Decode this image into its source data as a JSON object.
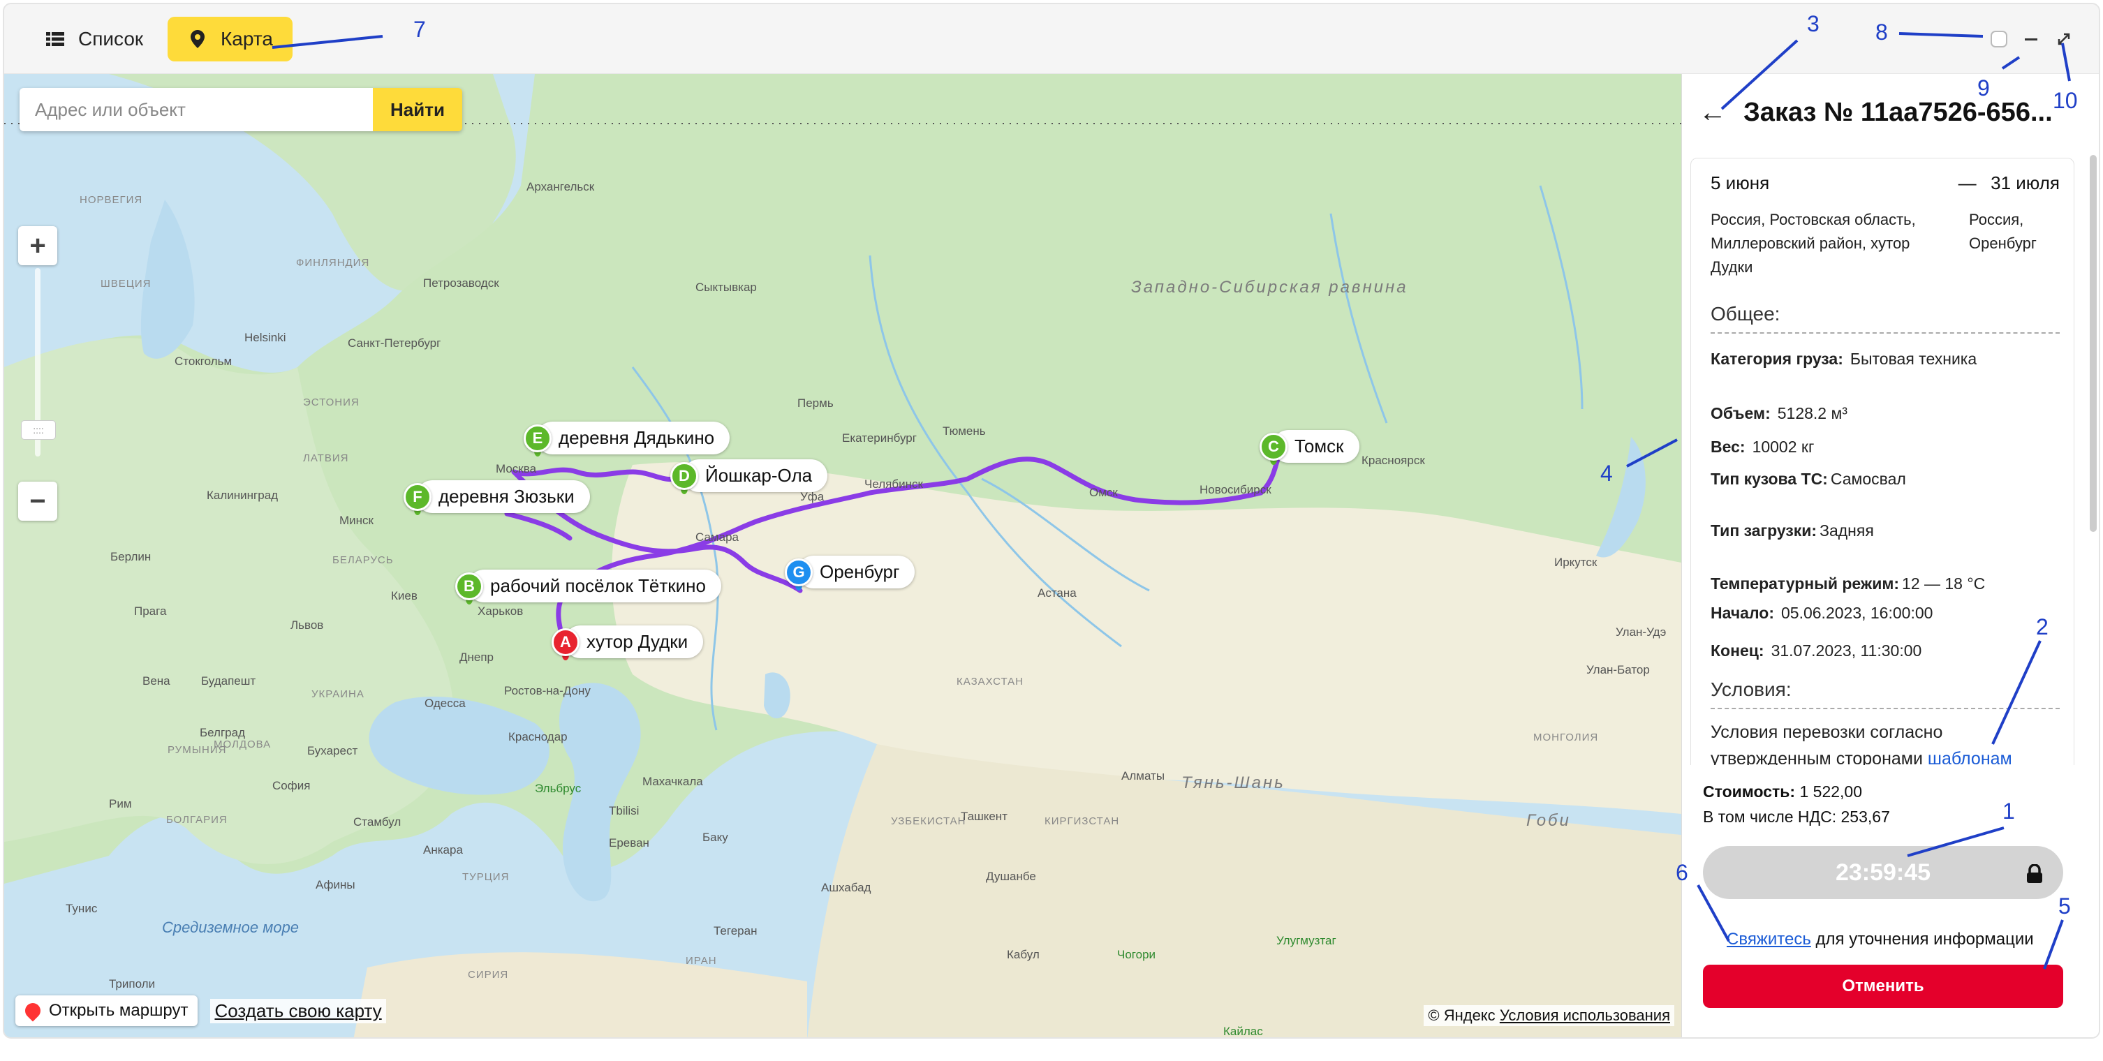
{
  "topbar": {
    "tab_list_label": "Список",
    "tab_map_label": "Карта",
    "list_icon": "list-icon",
    "map_icon": "map-pin-icon"
  },
  "window_controls": {
    "checkbox_icon": "checkbox-icon",
    "minimize_icon": "minimize-icon",
    "expand_icon": "expand-icon"
  },
  "map": {
    "search_placeholder": "Адрес или объект",
    "search_button": "Найти",
    "zoom_in": "+",
    "zoom_out": "−",
    "open_route": "Открыть маршрут",
    "create_map": "Создать свою карту",
    "copyright": "© Яндекс",
    "terms": "Условия использования",
    "route_color": "#8a3ce6",
    "markers": [
      {
        "letter": "A",
        "label": "хутор Дудки",
        "color": "#e8232f"
      },
      {
        "letter": "B",
        "label": "рабочий посёлок Тёткино",
        "color": "#5cb82a"
      },
      {
        "letter": "C",
        "label": "Томск",
        "color": "#5cb82a"
      },
      {
        "letter": "D",
        "label": "Йошкар-Ола",
        "color": "#5cb82a"
      },
      {
        "letter": "E",
        "label": "деревня Дядькино",
        "color": "#5cb82a"
      },
      {
        "letter": "F",
        "label": "деревня Зюзьки",
        "color": "#5cb82a"
      },
      {
        "letter": "G",
        "label": "Оренбург",
        "color": "#1e8ff0"
      }
    ],
    "place_labels": {
      "norway": "НОРВЕГИЯ",
      "sweden": "ШВЕЦИЯ",
      "finland": "ФИНЛЯНДИЯ",
      "estonia": "ЭСТОНИЯ",
      "latvia": "ЛАТВИЯ",
      "belarus": "БЕЛАРУСЬ",
      "ukraine": "УКРАИНА",
      "moldova": "МОЛДОВА",
      "romania": "РУМЫНИЯ",
      "bulgaria": "БОЛГАРИЯ",
      "turkey": "ТУРЦИЯ",
      "syria": "СИРИЯ",
      "iran": "ИРАН",
      "kazakhstan": "КАЗАХСТАН",
      "uzbekistan": "УЗБЕКИСТАН",
      "kyrgyzstan": "КИРГИЗСТАН",
      "mongolia": "МОНГОЛИЯ",
      "arkhangelsk": "Архангельск",
      "helsinki": "Helsinki",
      "stockholm": "Стокгольм",
      "spb": "Санкт-Петербург",
      "petrozavodsk": "Петрозаводск",
      "syktyvkar": "Сыктывкар",
      "perm": "Пермь",
      "yekaterinburg": "Екатеринбург",
      "tyumen": "Тюмень",
      "chelyabinsk": "Челябинск",
      "ufa": "Уфа",
      "samara": "Самара",
      "moscow": "Москва",
      "omsk": "Омск",
      "novosibirsk": "Новосибирск",
      "krasnoyarsk": "Красноярск",
      "irkutsk": "Иркутск",
      "ulanude": "Улан-Удэ",
      "ulaanbaatar": "Улан-Батор",
      "astana": "Астана",
      "almaty": "Алматы",
      "tashkent": "Ташкент",
      "dushanbe": "Душанбе",
      "ashgabat": "Ашхабад",
      "kabul": "Кабул",
      "tehran": "Тегеран",
      "tbilisi": "Tbilisi",
      "yerevan": "Ереван",
      "baku": "Баку",
      "makhachkala": "Махачкала",
      "krasnodar": "Краснодар",
      "rostov": "Ростов-на-Дону",
      "kharkov": "Харьков",
      "kiev": "Киев",
      "dnepr": "Днепр",
      "odessa": "Одесса",
      "lvov": "Львов",
      "minsk": "Минск",
      "kaliningrad": "Калининград",
      "berlin": "Берлин",
      "prague": "Прага",
      "vienna": "Вена",
      "budapest": "Будапешт",
      "belgrade": "Белград",
      "bucharest": "Бухарест",
      "sofia": "София",
      "istanbul": "Стамбул",
      "ankara": "Анкара",
      "athens": "Афины",
      "rome": "Рим",
      "tunis": "Тунис",
      "tripoli": "Триполи",
      "mediterranean": "Средиземное море",
      "west_siberian_plain": "Западно-Сибирская равнина",
      "tian_shan": "Тянь-Шань",
      "gobi": "Гоби",
      "elbrus": "Эльбрус",
      "chogori": "Чогори",
      "ulugmuztag": "Улугмузтаг",
      "kailas": "Кайлас"
    }
  },
  "panel": {
    "back_icon": "arrow-left-icon",
    "title": "Заказ № 11aa7526-656...",
    "date_start": "5 июня",
    "date_sep": "—",
    "date_end": "31 июля",
    "addr_from": "Россия, Ростовская область, Миллеровский район, хутор Дудки",
    "addr_to": "Россия, Оренбург",
    "general_title": "Общее:",
    "cargo_key": "Категория груза:",
    "cargo_val": "Бытовая техника",
    "volume_key": "Объем:",
    "volume_val": "5128.2 м³",
    "weight_key": "Вес:",
    "weight_val": "10002 кг",
    "body_key": "Тип кузова ТС:",
    "body_val": "Самосвал",
    "loading_key": "Тип загрузки:",
    "loading_val": "Задняя",
    "temp_key": "Температурный режим:",
    "temp_val": "12 — 18 °C",
    "start_key": "Начало:",
    "start_val": "05.06.2023, 16:00:00",
    "end_key": "Конец:",
    "end_val": "31.07.2023, 11:30:00",
    "conditions_title": "Условия:",
    "conditions_text": "Условия перевозки согласно утвержденным сторонами",
    "conditions_link": "шаблонам",
    "cost_key": "Стоимость:",
    "cost_val": "1 522,00",
    "vat_text": "В том числе НДС: 253,67",
    "timer": "23:59:45",
    "lock_icon": "lock-icon",
    "contact_link": "Свяжитесь",
    "contact_text": "для уточнения информации",
    "cancel_button": "Отменить"
  },
  "annotations": {
    "n1": "1",
    "n2": "2",
    "n3": "3",
    "n4": "4",
    "n5": "5",
    "n6": "6",
    "n7": "7",
    "n8": "8",
    "n9": "9",
    "n10": "10",
    "color": "#1f3fc7"
  }
}
